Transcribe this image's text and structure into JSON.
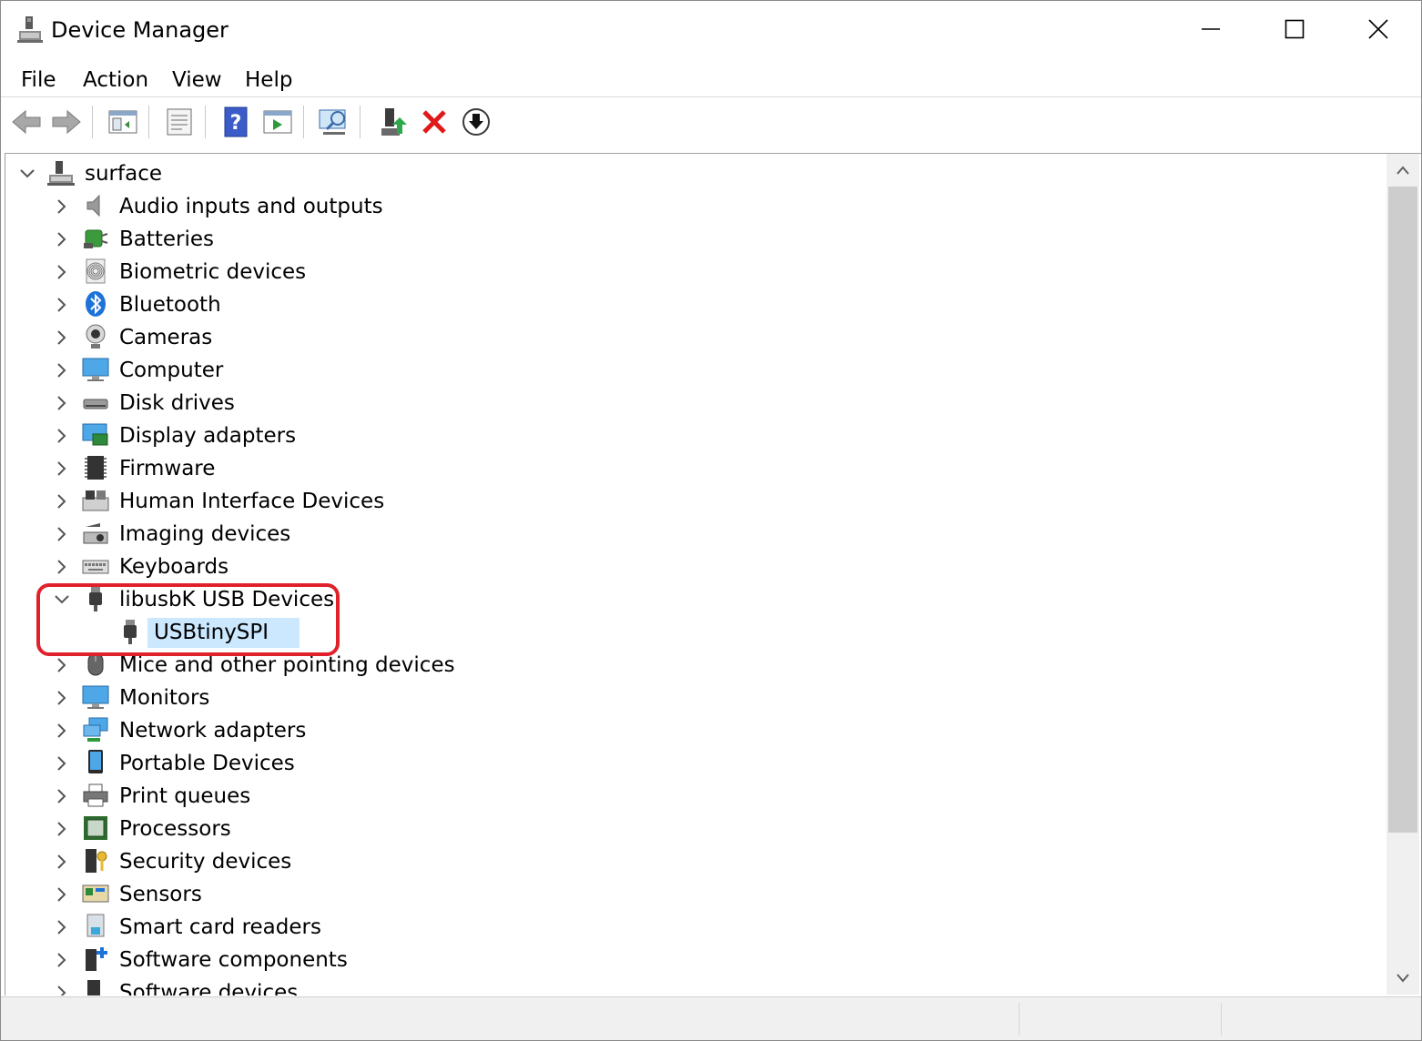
{
  "window": {
    "title": "Device Manager"
  },
  "menu": {
    "file": "File",
    "action": "Action",
    "view": "View",
    "help": "Help"
  },
  "toolbar": {
    "icons": [
      "back-arrow",
      "forward-arrow",
      "show-hide-console-tree",
      "properties",
      "help",
      "run",
      "scan-hardware",
      "update-driver",
      "uninstall-device",
      "install-driver"
    ]
  },
  "tree": {
    "root": "surface",
    "categories": [
      {
        "label": "Audio inputs and outputs",
        "icon": "speaker-icon"
      },
      {
        "label": "Batteries",
        "icon": "battery-icon"
      },
      {
        "label": "Biometric devices",
        "icon": "fingerprint-icon"
      },
      {
        "label": "Bluetooth",
        "icon": "bluetooth-icon"
      },
      {
        "label": "Cameras",
        "icon": "camera-icon"
      },
      {
        "label": "Computer",
        "icon": "monitor-icon"
      },
      {
        "label": "Disk drives",
        "icon": "disk-drive-icon"
      },
      {
        "label": "Display adapters",
        "icon": "display-adapter-icon"
      },
      {
        "label": "Firmware",
        "icon": "chip-icon"
      },
      {
        "label": "Human Interface Devices",
        "icon": "hid-icon"
      },
      {
        "label": "Imaging devices",
        "icon": "scanner-icon"
      },
      {
        "label": "Keyboards",
        "icon": "keyboard-icon"
      },
      {
        "label": "libusbK USB Devices",
        "icon": "usb-plug-icon",
        "expanded": true,
        "children": [
          {
            "label": "USBtinySPI",
            "icon": "usb-plug-icon",
            "selected": true
          }
        ]
      },
      {
        "label": "Mice and other pointing devices",
        "icon": "mouse-icon"
      },
      {
        "label": "Monitors",
        "icon": "monitor-icon"
      },
      {
        "label": "Network adapters",
        "icon": "network-icon"
      },
      {
        "label": "Portable Devices",
        "icon": "portable-device-icon"
      },
      {
        "label": "Print queues",
        "icon": "printer-icon"
      },
      {
        "label": "Processors",
        "icon": "processor-icon"
      },
      {
        "label": "Security devices",
        "icon": "security-key-icon"
      },
      {
        "label": "Sensors",
        "icon": "sensor-icon"
      },
      {
        "label": "Smart card readers",
        "icon": "smart-card-icon"
      },
      {
        "label": "Software components",
        "icon": "software-component-icon"
      },
      {
        "label": "Software devices",
        "icon": "software-device-icon"
      }
    ]
  },
  "colors": {
    "selection": "#cce8ff",
    "highlight_annotation": "#e0202a",
    "accent_blue": "#1e73d8"
  }
}
